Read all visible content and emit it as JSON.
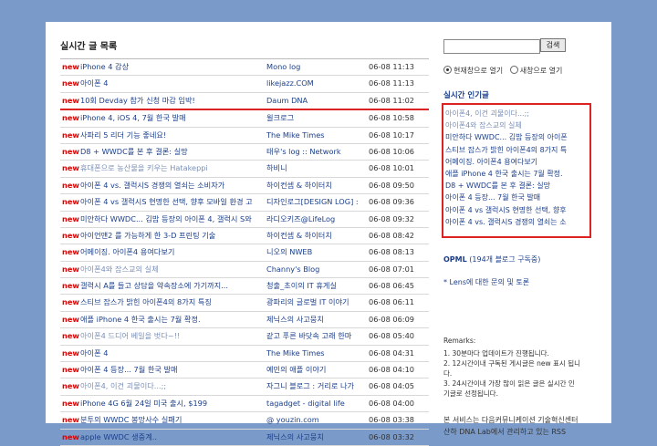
{
  "main": {
    "title": "실시간 글 목록",
    "new_label": "new",
    "rows": [
      {
        "title": "iPhone 4 감상",
        "source": "Mono log",
        "date": "06-08 11:13",
        "read": false
      },
      {
        "title": "아이폰 4",
        "source": "likejazz.COM",
        "date": "06-08 11:13",
        "read": false
      },
      {
        "title": "10회 Devday 참가 신청 마감 임박!",
        "source": "Daum DNA",
        "date": "06-08 11:02",
        "read": false
      },
      {
        "title": "iPhone 4, iOS 4, 7월 한국 발매",
        "source": "윌크로그",
        "date": "06-08 10:58",
        "read": false
      },
      {
        "title": "사파리 5 리더 기능 좋네요!",
        "source": "The Mike Times",
        "date": "06-08 10:17",
        "read": false
      },
      {
        "title": "D8 + WWDC를 본 후 결론: 실망",
        "source": "태우's log :: Network",
        "date": "06-08 10:06",
        "read": false
      },
      {
        "title": "휴대폰으로 농산물을 키우는 Hatakeppi",
        "source": "하비니",
        "date": "06-08 10:01",
        "read": true
      },
      {
        "title": "아이폰 4 vs. 갤럭시S 경쟁의 열쇠는 소비자가",
        "source": "하이컨셉 & 하이터치",
        "date": "06-08 09:50",
        "read": false
      },
      {
        "title": "아이폰 4 vs 갤럭시S 현명한 선택, 향후 모바일 환경 고",
        "source": "디자인로그[DESIGN LOG] :",
        "date": "06-08 09:36",
        "read": false
      },
      {
        "title": "미안하다 WWDC... 김밥 등장의 아이폰 4, 갤럭시 S와",
        "source": "라디오키즈@LifeLog",
        "date": "06-08 09:32",
        "read": false
      },
      {
        "title": "아이언맨2 를 가능하게 한 3-D 프린팅 기술",
        "source": "하이컨셉 & 하이터치",
        "date": "06-08 08:42",
        "read": false
      },
      {
        "title": "어메이징. 아이폰4 용여다보기",
        "source": "니오의 NWEB",
        "date": "06-08 08:13",
        "read": false
      },
      {
        "title": "아이폰4와 잡스교의 실체",
        "source": "Channy's Blog",
        "date": "06-08 07:01",
        "read": true
      },
      {
        "title": "갤럭시 A를 들고 상담을 약속장소에 가기까지...",
        "source": "청출_초이의 IT 휴게실",
        "date": "06-08 06:45",
        "read": false
      },
      {
        "title": "스티브 잡스가 밝힌 아이폰4의 8가지 특징",
        "source": "광파리의 글로벌 IT 이야기",
        "date": "06-08 06:11",
        "read": false
      },
      {
        "title": "애플 iPhone 4 한국 출시는 7월 확정.",
        "source": "제닉스의 사고뭉치",
        "date": "06-08 06:09",
        "read": false
      },
      {
        "title": "아이폰4 드디어 베일을 벗다~!!",
        "source": "같고 푸른 바닷속 고래 한마",
        "date": "06-08 05:40",
        "read": true
      },
      {
        "title": "아이폰 4",
        "source": "The Mike Times",
        "date": "06-08 04:31",
        "read": false
      },
      {
        "title": "아이폰 4 등장... 7월 한국 발매",
        "source": "예민의 애플 이야기",
        "date": "06-08 04:10",
        "read": false
      },
      {
        "title": "아이폰4, 이건 괴물이다...;;",
        "source": "자그니 블로그 : 거리로 나가",
        "date": "06-08 04:05",
        "read": true
      },
      {
        "title": "iPhone 4G 6월 24일 미국 출시, $199",
        "source": "tagadget - digital life",
        "date": "06-08 04:00",
        "read": false
      },
      {
        "title": "분투의 WWDC 봉망사수 실패기",
        "source": "@ youzin.com",
        "date": "06-08 03:38",
        "read": false
      },
      {
        "title": "apple WWDC 생중계..",
        "source": "제닉스의 사고뭉치",
        "date": "06-08 03:32",
        "read": false
      }
    ]
  },
  "side": {
    "search_placeholder": "",
    "search_button": "검색",
    "radio_current": "현재창으로 열기",
    "radio_new": "새창으로 열기",
    "popular_title": "실시간 인기글",
    "popular": [
      {
        "text": "아이폰4, 이건 괴물이다...;;",
        "gray": true
      },
      {
        "text": "아이폰4와 잡스교의 실체",
        "gray": true
      },
      {
        "text": "미안하다 WWDC... 김밥 등장의 아이폰",
        "gray": false
      },
      {
        "text": "스티브 잡스가 밝힌 아이폰4의 8가지 특",
        "gray": false
      },
      {
        "text": "어메이징. 아이폰4 용여다보기",
        "gray": false
      },
      {
        "text": "애플 iPhone 4 한국 출시는 7월 확정.",
        "gray": false
      },
      {
        "text": "D8 + WWDC를 본 후 결론: 실망",
        "gray": false
      },
      {
        "text": "아이폰 4 등장... 7월 한국 발매",
        "gray": false
      },
      {
        "text": "아이폰 4 vs 갤럭시S 현명한 선택, 향후",
        "gray": false
      },
      {
        "text": "아이폰 4 vs. 갤럭시S 경쟁의 열쇠는 소",
        "gray": false
      }
    ],
    "opml_label": "OPML",
    "opml_count": "(194개 블로그 구독중)",
    "lens_text": "* Lens에 대한 문의 및 토론",
    "remarks_title": "Remarks:",
    "remarks": [
      "1. 30분마다 업데이트가 진행됩니다.",
      "2. 12시간이내 구독된 게시글은 new 표시 됩니다.",
      "3. 24시간이내 가장 많이 읽은 글은 실시간 인기글로 선정됩니다."
    ],
    "service_text": "본 서비스는 다음커뮤니케이션 기술혁신센터 산하 DNA Lab에서 관리하고 있는 RSS"
  }
}
